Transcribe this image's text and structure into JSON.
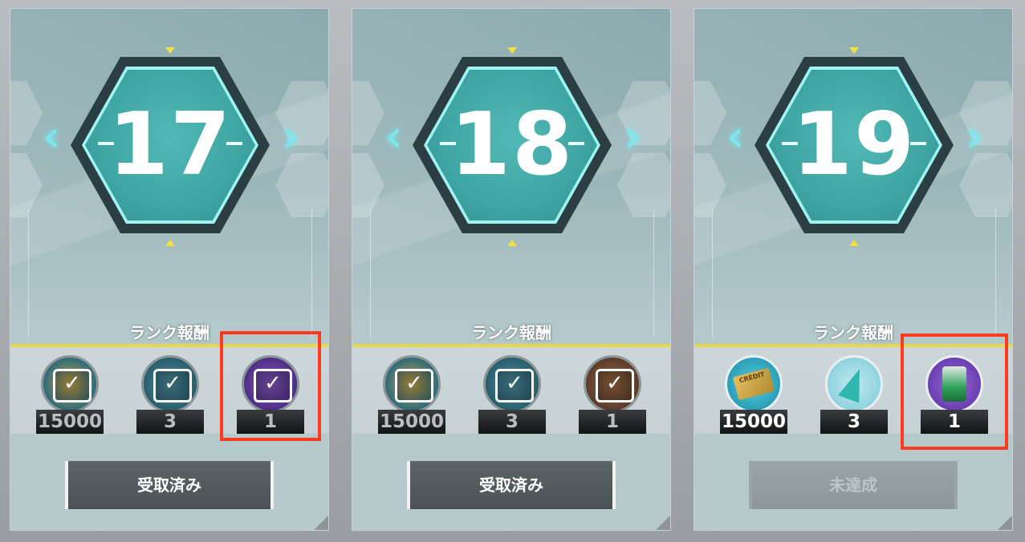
{
  "cards": [
    {
      "rank": "17",
      "reward_title": "ランク報酬",
      "rewards": [
        {
          "icon": "credit-icon",
          "amount": "15000",
          "state": "claimed"
        },
        {
          "icon": "crystal-icon",
          "amount": "3",
          "state": "claimed"
        },
        {
          "icon": "purple-item-icon",
          "amount": "1",
          "state": "claimed"
        }
      ],
      "button_label": "受取済み",
      "button_state": "claimed"
    },
    {
      "rank": "18",
      "reward_title": "ランク報酬",
      "rewards": [
        {
          "icon": "credit-icon",
          "amount": "15000",
          "state": "claimed"
        },
        {
          "icon": "crystal-icon",
          "amount": "3",
          "state": "claimed"
        },
        {
          "icon": "brown-item-icon",
          "amount": "1",
          "state": "claimed"
        }
      ],
      "button_label": "受取済み",
      "button_state": "claimed"
    },
    {
      "rank": "19",
      "reward_title": "ランク報酬",
      "rewards": [
        {
          "icon": "credit-card-icon",
          "amount": "15000",
          "state": "unclaimed"
        },
        {
          "icon": "crystal-icon",
          "amount": "3",
          "state": "unclaimed"
        },
        {
          "icon": "bottle-icon",
          "amount": "1",
          "state": "unclaimed"
        }
      ],
      "button_label": "未達成",
      "button_state": "disabled"
    }
  ],
  "credit_card_text": "CREDIT",
  "colors": {
    "accent_yellow": "#e6d84a",
    "highlight_red": "#ff3b1f",
    "hex_teal": "#3fa5a2"
  }
}
